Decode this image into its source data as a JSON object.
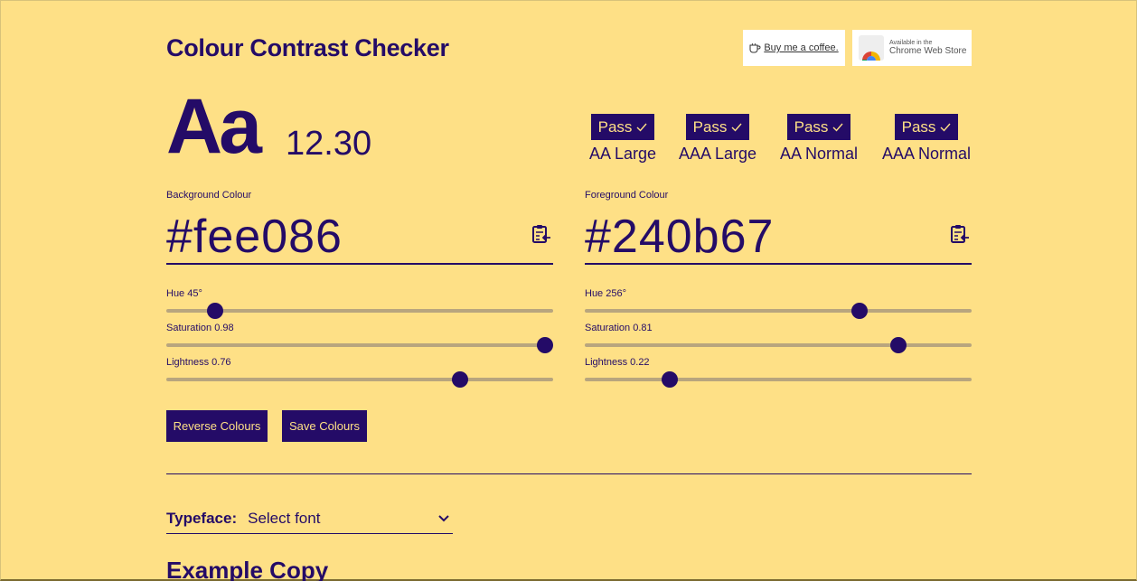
{
  "header": {
    "title": "Colour Contrast Checker",
    "coffee_label": "Buy me a coffee.",
    "webstore_small": "Available in the",
    "webstore_big": "Chrome Web Store"
  },
  "preview": {
    "sample": "Aa",
    "ratio": "12.30"
  },
  "badges": [
    {
      "status": "Pass",
      "label": "AA Large"
    },
    {
      "status": "Pass",
      "label": "AAA Large"
    },
    {
      "status": "Pass",
      "label": "AA Normal"
    },
    {
      "status": "Pass",
      "label": "AAA Normal"
    }
  ],
  "background": {
    "label": "Background Colour",
    "hex": "#fee086",
    "hue_label": "Hue 45°",
    "saturation_label": "Saturation 0.98",
    "lightness_label": "Lightness 0.76",
    "hue_fraction": 0.125,
    "saturation_fraction": 0.98,
    "lightness_fraction": 0.76
  },
  "foreground": {
    "label": "Foreground Colour",
    "hex": "#240b67",
    "hue_label": "Hue 256°",
    "saturation_label": "Saturation 0.81",
    "lightness_label": "Lightness 0.22",
    "hue_fraction": 0.711,
    "saturation_fraction": 0.81,
    "lightness_fraction": 0.22
  },
  "actions": {
    "reverse_label": "Reverse Colours",
    "save_label": "Save Colours"
  },
  "typeface": {
    "label": "Typeface:",
    "value": "Select font"
  },
  "example": {
    "heading": "Example Copy"
  },
  "colors": {
    "background": "#fee086",
    "foreground": "#240b67",
    "track": "#b8a57e"
  }
}
